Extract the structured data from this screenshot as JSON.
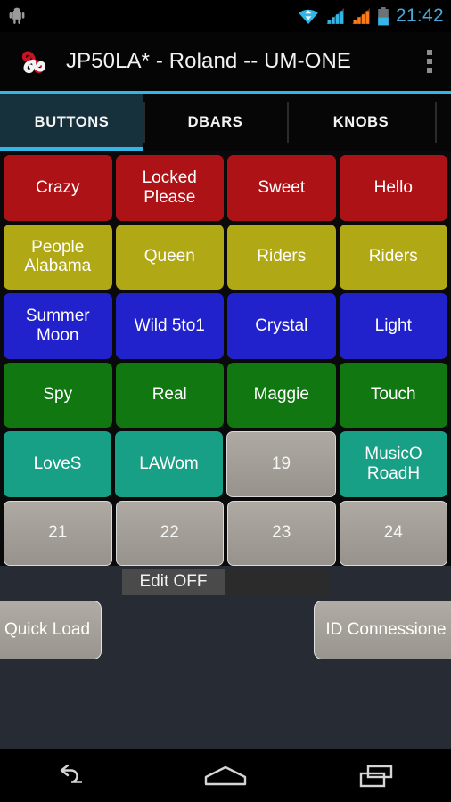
{
  "statusbar": {
    "clock": "21:42",
    "icons": {
      "android": "android-robot-icon",
      "wifi": "wifi-icon",
      "signal1": "signal-bars-icon",
      "signal2": "signal-bars-orange-icon",
      "battery": "battery-icon"
    },
    "colors": {
      "clock": "#4aa8d8",
      "wifi": "#33b5e5",
      "signal_primary": "#33b5e5",
      "signal_secondary": "#ff7b17",
      "battery": "#33b5e5"
    }
  },
  "titlebar": {
    "title": "JP50LA* - Roland -- UM-ONE",
    "logo": "app-logo-pinwheel-icon",
    "overflow": "overflow-menu-icon"
  },
  "tabs": {
    "accent": "#33b5e5",
    "items": [
      {
        "label": "BUTTONS",
        "active": true
      },
      {
        "label": "DBARS",
        "active": false
      },
      {
        "label": "KNOBS",
        "active": false
      }
    ]
  },
  "grid": {
    "colors": {
      "red": "#ad1316",
      "olive": "#b0a814",
      "blue": "#2222cc",
      "green": "#117711",
      "teal": "#17a085",
      "gray": "#a5a19a"
    },
    "rows": [
      [
        {
          "label": "Crazy",
          "color": "red"
        },
        {
          "label": "Locked\nPlease",
          "color": "red"
        },
        {
          "label": "Sweet",
          "color": "red"
        },
        {
          "label": "Hello",
          "color": "red"
        }
      ],
      [
        {
          "label": "People\nAlabama",
          "color": "olive"
        },
        {
          "label": "Queen",
          "color": "olive"
        },
        {
          "label": "Riders",
          "color": "olive"
        },
        {
          "label": "Riders",
          "color": "olive"
        }
      ],
      [
        {
          "label": "Summer\nMoon",
          "color": "blue"
        },
        {
          "label": "Wild 5to1",
          "color": "blue"
        },
        {
          "label": "Crystal",
          "color": "blue"
        },
        {
          "label": "Light",
          "color": "blue"
        }
      ],
      [
        {
          "label": "Spy",
          "color": "green"
        },
        {
          "label": "Real",
          "color": "green"
        },
        {
          "label": "Maggie",
          "color": "green"
        },
        {
          "label": "Touch",
          "color": "green"
        }
      ],
      [
        {
          "label": "LoveS",
          "color": "teal"
        },
        {
          "label": "LAWom",
          "color": "teal"
        },
        {
          "label": "19",
          "color": "gray"
        },
        {
          "label": "MusicO\nRoadH",
          "color": "teal"
        }
      ],
      [
        {
          "label": "21",
          "color": "gray"
        },
        {
          "label": "22",
          "color": "gray"
        },
        {
          "label": "23",
          "color": "gray"
        },
        {
          "label": "24",
          "color": "gray"
        }
      ]
    ]
  },
  "edit": {
    "toggle_label": "Edit OFF"
  },
  "bottom": {
    "quick_load_label": "Quick Load",
    "id_connessione_label": "ID Connessione"
  },
  "navbar": {
    "back": "back-arrow-icon",
    "home": "home-icon",
    "recents": "recent-apps-icon"
  }
}
